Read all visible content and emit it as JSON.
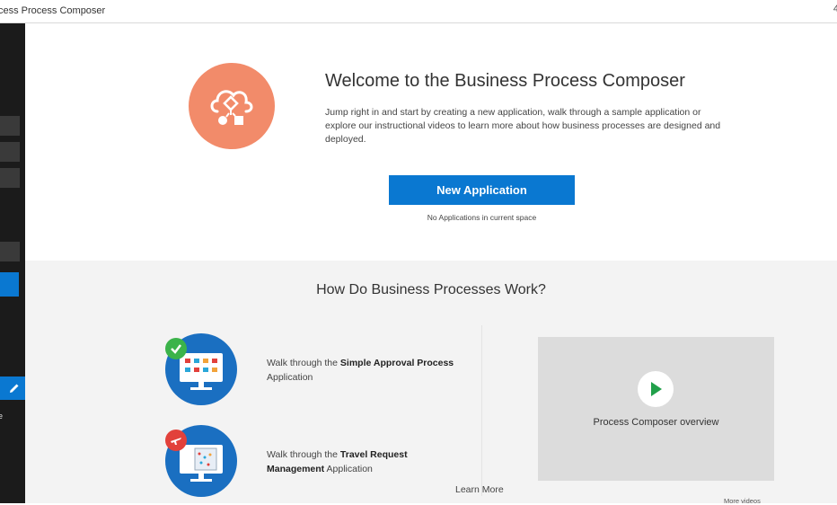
{
  "window": {
    "title": "cess Process Composer",
    "edge_control": "4"
  },
  "sidebar": {
    "tail_text": "e"
  },
  "welcome": {
    "title": "Welcome to the Business Process Composer",
    "description": "Jump right in and start by creating a new application, walk through a sample application or explore our instructional videos to learn more about how business processes are designed and deployed.",
    "new_application_label": "New Application",
    "no_apps_text": "No Applications in current space"
  },
  "how": {
    "title": "How Do Business Processes Work?",
    "samples": [
      {
        "prefix": "Walk through the ",
        "bold": "Simple Approval Process",
        "suffix": " Application",
        "badge_color": "#3bb34a",
        "badge_icon": "check-icon"
      },
      {
        "prefix": "Walk through the ",
        "bold": "Travel Request Management",
        "suffix": " Application",
        "badge_color": "#e2413b",
        "badge_icon": "airplane-icon"
      }
    ],
    "learn_more": "Learn More",
    "video": {
      "label": "Process Composer overview",
      "play_color": "#21a04a"
    },
    "more_videos": "More videos"
  },
  "colors": {
    "accent": "#0a78d1",
    "hero": "#f28b6a",
    "sample_icon_bg": "#1a6fc1"
  }
}
